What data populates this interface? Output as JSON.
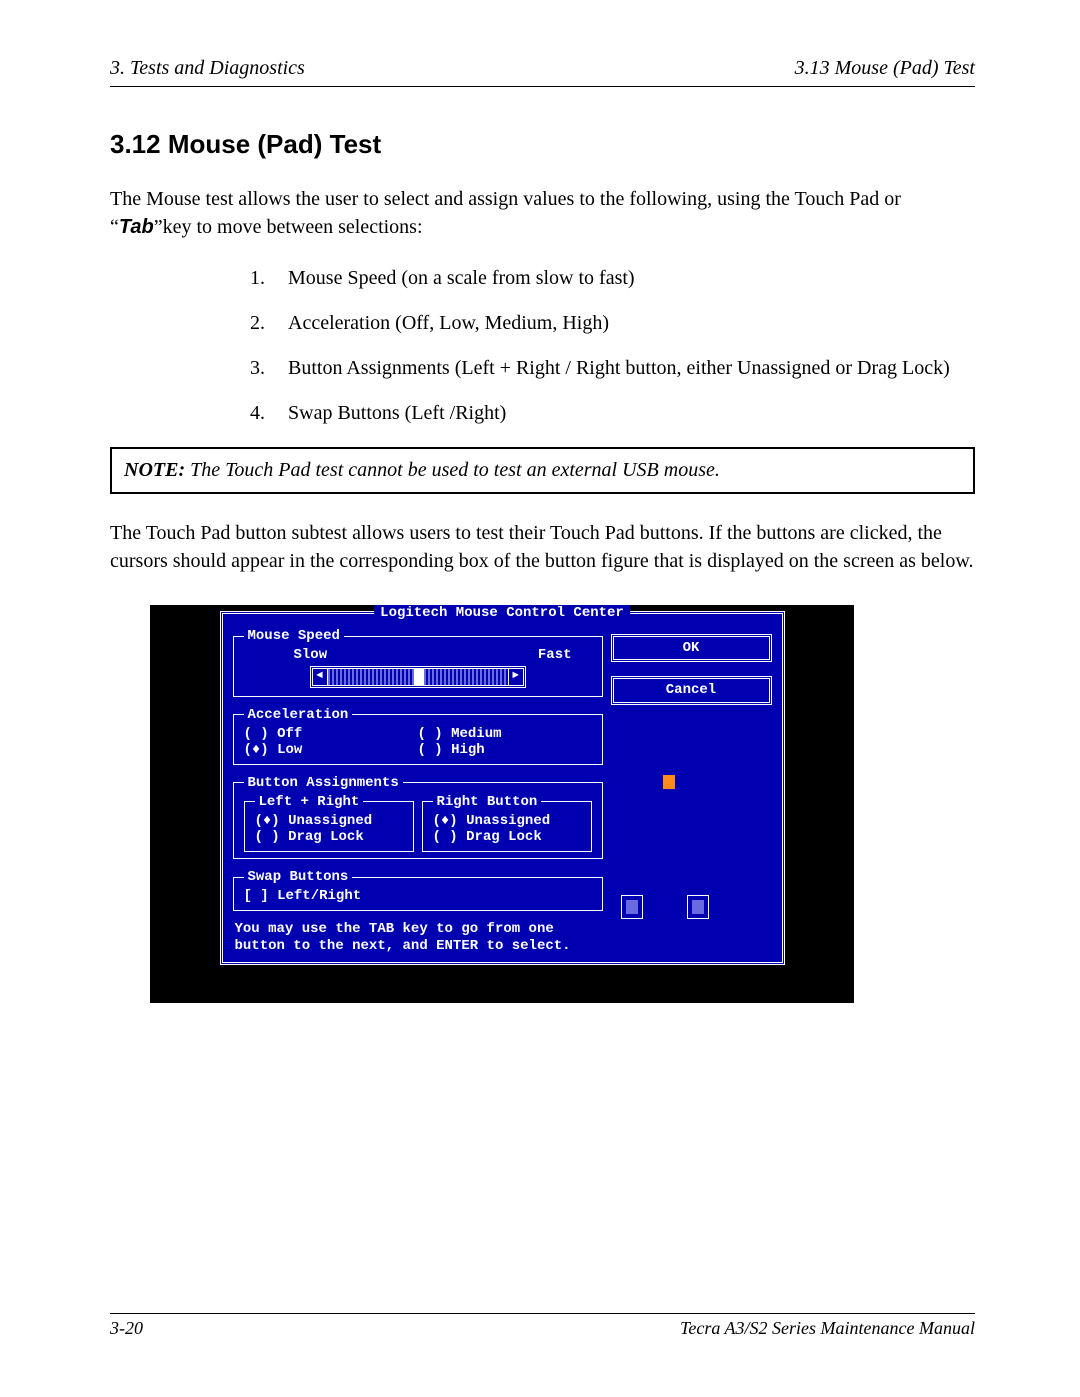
{
  "header": {
    "left": "3.  Tests and Diagnostics",
    "right": "3.13  Mouse (Pad) Test"
  },
  "section": {
    "heading": "3.12  Mouse (Pad) Test",
    "intro_pre": "The Mouse test allows the user to select and assign values to the following, using the Touch Pad or “",
    "tab_word": "Tab",
    "intro_post": "”key to move between selections:",
    "list": [
      "Mouse Speed (on a scale from slow to fast)",
      "Acceleration (Off, Low, Medium, High)",
      "Button Assignments (Left + Right / Right button, either Unassigned or Drag Lock)",
      "Swap Buttons (Left /Right)"
    ],
    "note_label": "NOTE:",
    "note_text": "  The Touch Pad test cannot be used to test an external USB mouse.",
    "para2": "The Touch Pad button subtest allows users to test their Touch Pad buttons. If the buttons are clicked, the cursors should appear in the corresponding box of the button figure that is displayed on the screen as below."
  },
  "dos": {
    "title": "Logitech Mouse Control Center",
    "mouse_speed": {
      "legend": "Mouse Speed",
      "slow": "Slow",
      "fast": "Fast"
    },
    "accel": {
      "legend": "Acceleration",
      "off": "( ) Off",
      "low": "(♦) Low",
      "med": "( ) Medium",
      "high": "( ) High"
    },
    "btn_assign": {
      "legend": "Button Assignments",
      "left_legend": "Left + Right",
      "right_legend": "Right Button",
      "l1": "(♦) Unassigned",
      "l2": "( ) Drag Lock",
      "r1": "(♦) Unassigned",
      "r2": "( ) Drag Lock"
    },
    "swap": {
      "legend": "Swap Buttons",
      "opt": "[ ] Left/Right"
    },
    "hint1": "You may use the TAB key to go from one",
    "hint2": "button to the next, and ENTER to select.",
    "ok": "OK",
    "cancel": "Cancel"
  },
  "footer": {
    "page": "3-20",
    "manual": "Tecra A3/S2 Series Maintenance Manual"
  }
}
